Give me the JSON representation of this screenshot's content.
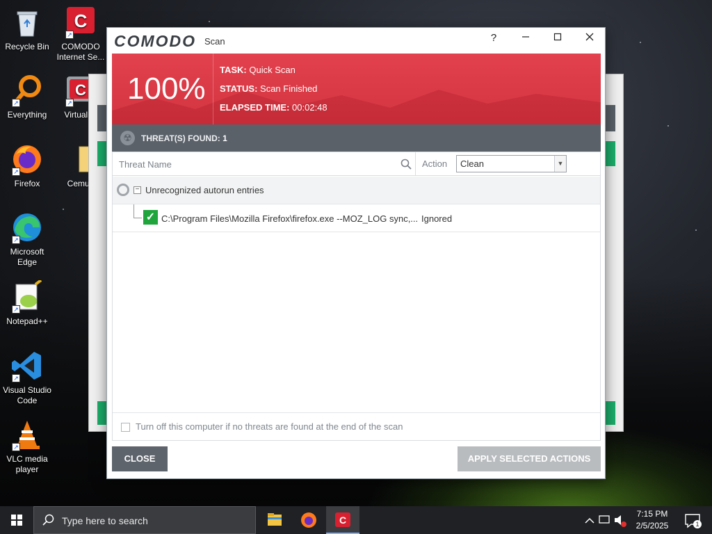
{
  "desktop": {
    "icons": [
      {
        "label": "Recycle Bin"
      },
      {
        "label": "COMODO Internet Se..."
      },
      {
        "label": "Everything"
      },
      {
        "label": "Virtual Fi"
      },
      {
        "label": "Firefox"
      },
      {
        "label": "Cemu_"
      },
      {
        "label": "Microsoft Edge"
      },
      {
        "label": "Notepad++"
      },
      {
        "label": "Visual Studio Code"
      },
      {
        "label": "VLC media player"
      }
    ]
  },
  "scan_window": {
    "logo": "COMODO",
    "title": "Scan",
    "help_label": "?",
    "banner": {
      "percent": "100%",
      "task_label": "TASK:",
      "task_value": "Quick Scan",
      "status_label": "STATUS:",
      "status_value": "Scan Finished",
      "elapsed_label": "ELAPSED TIME:",
      "elapsed_value": "00:02:48"
    },
    "threats": {
      "label": "THREAT(S) FOUND:",
      "count": "1"
    },
    "table": {
      "col_threat_name": "Threat Name",
      "col_action": "Action",
      "action_select_value": "Clean",
      "group_label": "Unrecognized autorun entries",
      "rows": [
        {
          "path": "C:\\Program Files\\Mozilla Firefox\\firefox.exe --MOZ_LOG sync,...",
          "status": "Ignored"
        }
      ]
    },
    "shutdown_option": "Turn off this computer if no threats are found at the end of the scan",
    "close_label": "CLOSE",
    "apply_label": "APPLY SELECTED ACTIONS"
  },
  "taskbar": {
    "search_placeholder": "Type here to search",
    "time": "7:15 PM",
    "date": "2/5/2025",
    "notification_count": "1"
  },
  "colors": {
    "banner_red": "#d9394a",
    "threat_bar": "#5a6169",
    "clean_green": "#1fa53c"
  }
}
